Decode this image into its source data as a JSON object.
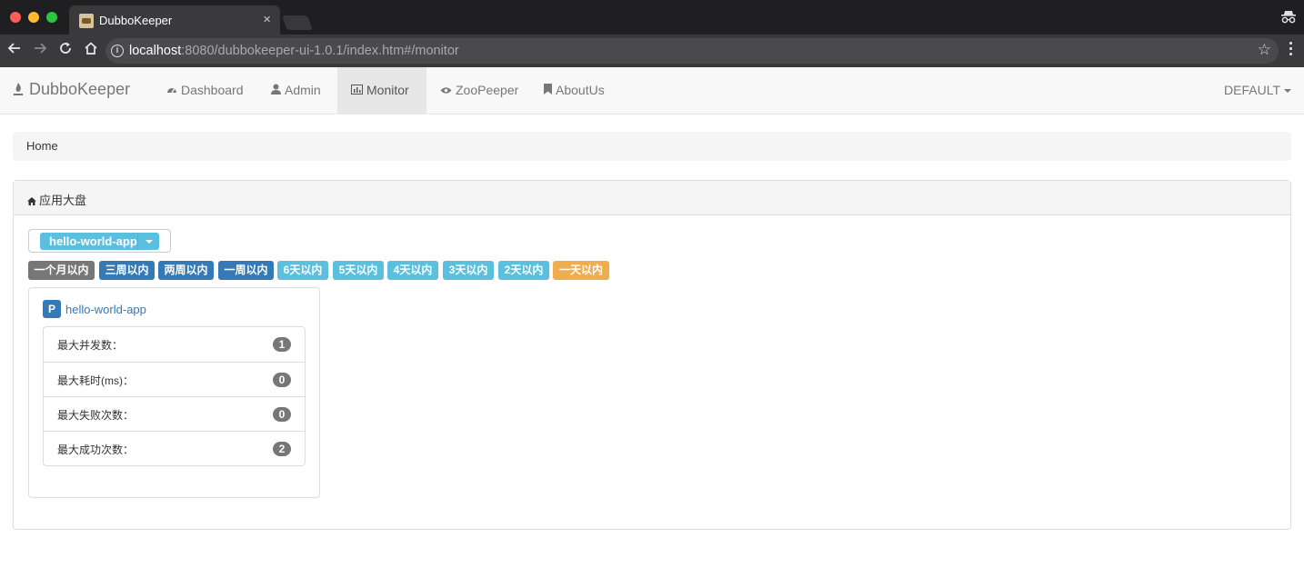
{
  "browser": {
    "tab_title": "DubboKeeper",
    "tab_close": "×",
    "url_host": "localhost",
    "url_path": ":8080/dubbokeeper-ui-1.0.1/index.htm#/monitor",
    "back_icon": "arrow-left-icon",
    "forward_icon": "arrow-right-icon",
    "reload_icon": "reload-icon",
    "home_icon": "home-icon"
  },
  "navbar": {
    "brand": "DubboKeeper",
    "items": [
      {
        "label": "Dashboard",
        "icon": "dashboard-icon"
      },
      {
        "label": "Admin",
        "icon": "user-icon"
      },
      {
        "label": "Monitor",
        "icon": "stats-icon",
        "active": true
      },
      {
        "label": "ZooPeeper",
        "icon": "eye-icon"
      },
      {
        "label": "AboutUs",
        "icon": "bookmark-icon"
      }
    ],
    "right_label": "DEFAULT"
  },
  "breadcrumb": {
    "label": "Home"
  },
  "panel": {
    "title": "应用大盘",
    "app_select": "hello-world-app",
    "ranges": [
      {
        "label": "一个月以内",
        "color": "#777777"
      },
      {
        "label": "三周以内",
        "color": "#337ab7"
      },
      {
        "label": "两周以内",
        "color": "#337ab7"
      },
      {
        "label": "一周以内",
        "color": "#337ab7"
      },
      {
        "label": "6天以内",
        "color": "#5bc0de"
      },
      {
        "label": "5天以内",
        "color": "#5bc0de"
      },
      {
        "label": "4天以内",
        "color": "#5bc0de"
      },
      {
        "label": "3天以内",
        "color": "#5bc0de"
      },
      {
        "label": "2天以内",
        "color": "#5bc0de"
      },
      {
        "label": "一天以内",
        "color": "#f0ad4e"
      }
    ],
    "card": {
      "badge": "P",
      "app_name": "hello-world-app",
      "stats": [
        {
          "label": "最大并发数：",
          "value": "1"
        },
        {
          "label": "最大耗时(ms)：",
          "value": "0"
        },
        {
          "label": "最大失败次数：",
          "value": "0"
        },
        {
          "label": "最大成功次数：",
          "value": "2"
        }
      ]
    }
  }
}
